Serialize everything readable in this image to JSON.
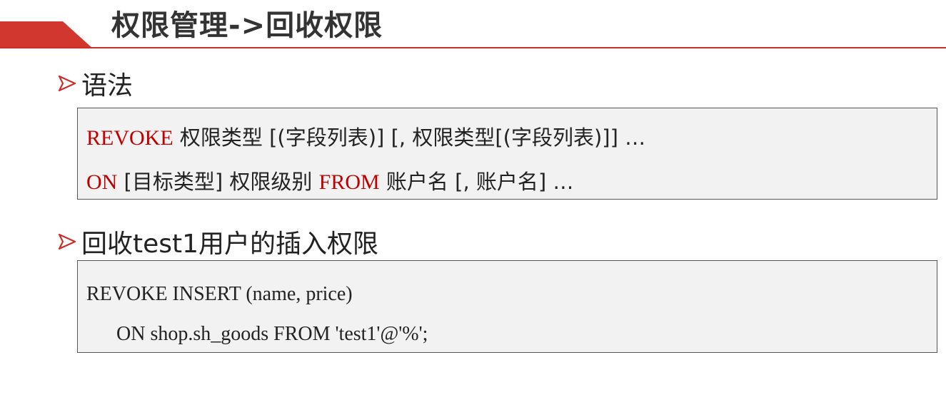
{
  "header": {
    "title": "权限管理->回收权限",
    "accent_color": "#d2372f"
  },
  "sections": [
    {
      "heading": "语法",
      "bullet_icon": "arrow-bullet-icon",
      "lines": [
        [
          {
            "text": "REVOKE",
            "style": "keyword"
          },
          {
            "text": " 权限类型 [(字段列表)] [, 权限类型[(字段列表)]] …",
            "style": "plain"
          }
        ],
        [
          {
            "text": "ON",
            "style": "keyword"
          },
          {
            "text": " [目标类型] 权限级别 ",
            "style": "plain"
          },
          {
            "text": "FROM",
            "style": "keyword"
          },
          {
            "text": " 账户名 [, 账户名] …",
            "style": "plain"
          }
        ]
      ]
    },
    {
      "heading": "回收test1用户的插入权限",
      "bullet_icon": "arrow-bullet-icon",
      "lines": [
        [
          {
            "text": "REVOKE INSERT (name, price)",
            "style": "plain"
          }
        ],
        [
          {
            "text": "ON shop.sh_goods FROM 'test1'@'%';",
            "style": "plain"
          }
        ]
      ]
    }
  ],
  "colors": {
    "keyword": "#c00000",
    "code_background": "#f2f2f2",
    "border": "#555555"
  }
}
